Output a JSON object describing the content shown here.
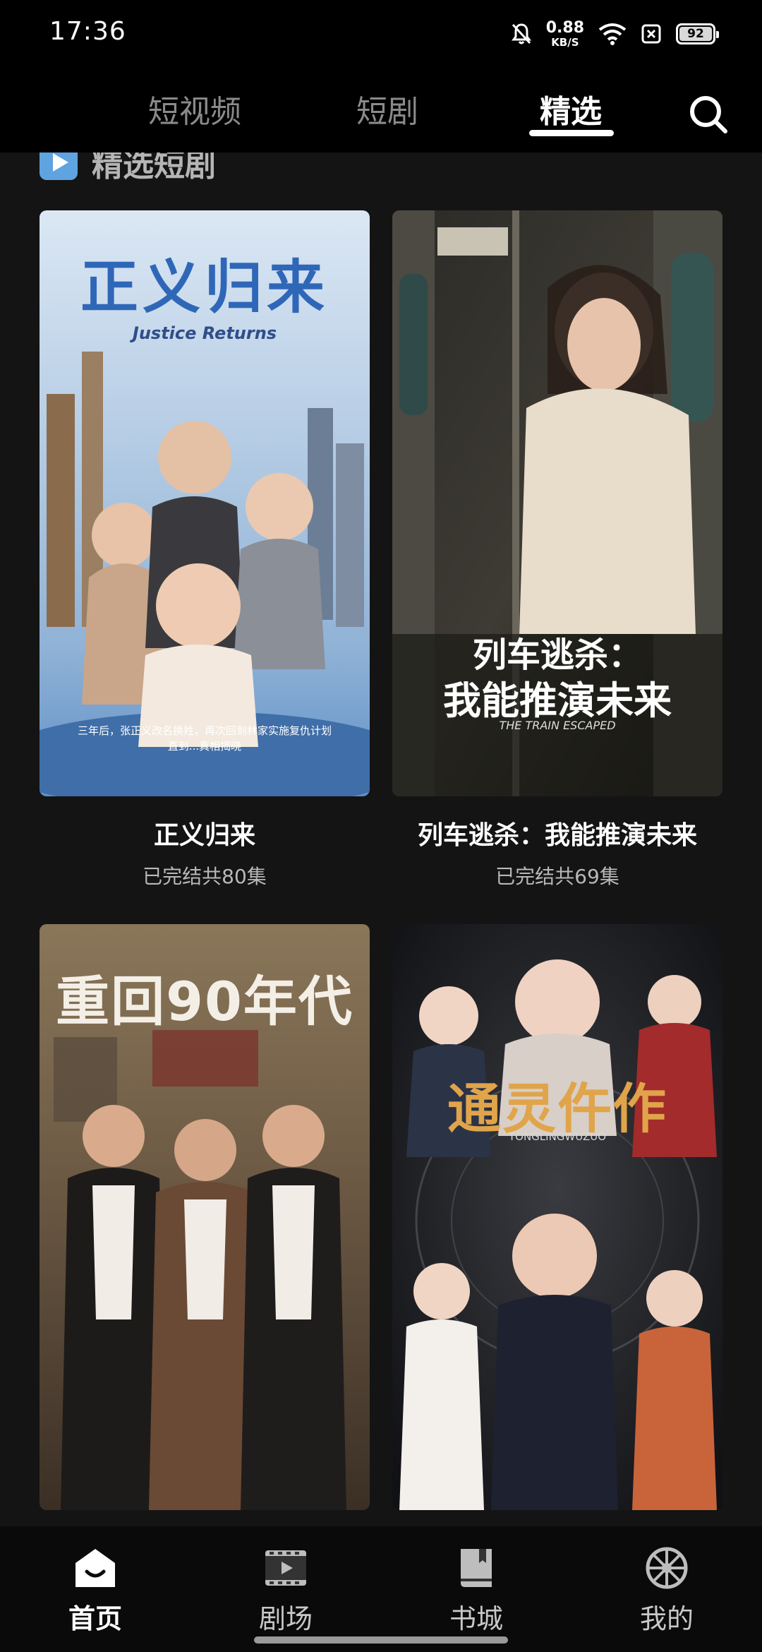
{
  "status_bar": {
    "time": "17:36",
    "net_speed_value": "0.88",
    "net_speed_unit": "KB/S",
    "battery_level": "92",
    "battery_fraction": 0.92,
    "icons": [
      "bell-off-icon",
      "wifi-icon",
      "sim-off-icon",
      "battery-icon"
    ]
  },
  "top_tabs": [
    {
      "label": "短视频",
      "active": false
    },
    {
      "label": "短剧",
      "active": false
    },
    {
      "label": "精选",
      "active": true
    }
  ],
  "section": {
    "title": "精选短剧",
    "icon": "play-icon"
  },
  "cards": [
    {
      "title": "正义归来",
      "subtitle": "已完结共80集",
      "poster": {
        "title": "正义归来",
        "subtitle": "Justice Returns",
        "caption_line1": "三年后，张正义改名换姓，再次回到林家实施复仇计划",
        "caption_line2": "直到...真相揭晓"
      }
    },
    {
      "title": "列车逃杀：我能推演未来",
      "subtitle": "已完结共69集",
      "poster": {
        "title_line1": "列车逃杀：",
        "title_line2": "我能推演未来",
        "subtitle": "THE TRAIN ESCAPED"
      }
    },
    {
      "title": "",
      "subtitle": "",
      "poster": {
        "title": "重回90年代"
      }
    },
    {
      "title": "",
      "subtitle": "",
      "poster": {
        "title": "通灵仵作",
        "subtitle": "TONGLINGWUZUO"
      }
    }
  ],
  "bottom_nav": [
    {
      "label": "首页",
      "icon": "home-icon",
      "active": true
    },
    {
      "label": "剧场",
      "icon": "theater-icon",
      "active": false
    },
    {
      "label": "书城",
      "icon": "book-icon",
      "active": false
    },
    {
      "label": "我的",
      "icon": "profile-wheel-icon",
      "active": false
    }
  ],
  "colors": {
    "background": "#141414",
    "bar": "#000000",
    "accent": "#5fa3e0"
  }
}
